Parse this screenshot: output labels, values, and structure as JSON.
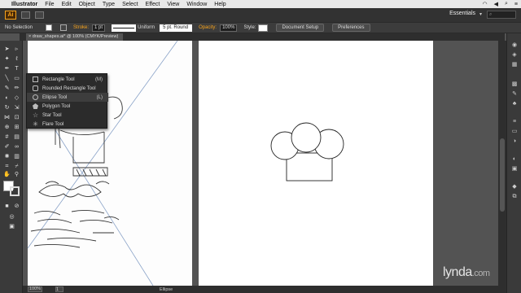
{
  "menubar": {
    "app_name": "Illustrator",
    "items": [
      "File",
      "Edit",
      "Object",
      "Type",
      "Select",
      "Effect",
      "View",
      "Window",
      "Help"
    ]
  },
  "appbar": {
    "logo": "Ai",
    "workspace": "Essentials"
  },
  "control": {
    "selection": "No Selection",
    "stroke_label": "Stroke:",
    "stroke_weight": "1 pt",
    "profile": "Uniform",
    "brush": "5 pt. Round",
    "opacity_label": "Opacity:",
    "opacity_value": "100%",
    "style_label": "Style:",
    "document_setup": "Document Setup",
    "preferences": "Preferences"
  },
  "document": {
    "tab_title": "draw_shapes.ai* @ 100% (CMYK/Preview)"
  },
  "flyout": {
    "items": [
      {
        "label": "Rectangle Tool",
        "shortcut": "(M)"
      },
      {
        "label": "Rounded Rectangle Tool",
        "shortcut": ""
      },
      {
        "label": "Ellipse Tool",
        "shortcut": "(L)"
      },
      {
        "label": "Polygon Tool",
        "shortcut": ""
      },
      {
        "label": "Star Tool",
        "shortcut": ""
      },
      {
        "label": "Flare Tool",
        "shortcut": ""
      }
    ],
    "selected_index": 2
  },
  "statusbar": {
    "zoom": "100%",
    "page": "1",
    "current_tool": "Ellipse"
  },
  "watermark": {
    "text": "lynda",
    "suffix": ".com"
  },
  "colors": {
    "accent": "#f7a31c",
    "panel": "#3a3a3a",
    "canvas_bg": "#535353"
  }
}
